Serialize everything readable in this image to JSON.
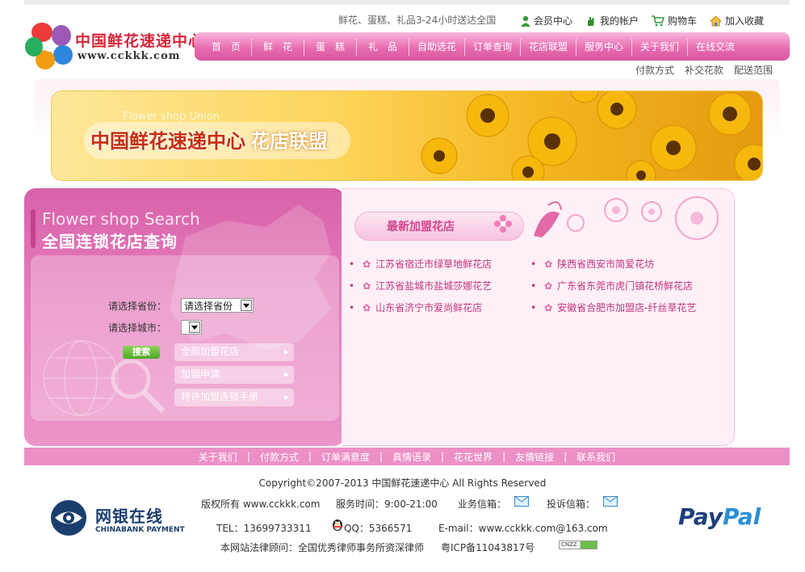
{
  "header": {
    "logo_cn": "中国鲜花速递中心",
    "logo_en": "www.cckkk.com",
    "tagline": "鲜花、蛋糕、礼品3-24小时送达全国",
    "toplinks": [
      "会员中心",
      "我的帐户",
      "购物车",
      "加入收藏"
    ]
  },
  "nav": {
    "items": [
      "首　页",
      "鲜　花",
      "蛋　糕",
      "礼　品",
      "自助选花",
      "订单查询",
      "花店联盟",
      "服务中心",
      "关于我们",
      "在线交流"
    ]
  },
  "subnav": [
    "付款方式",
    "补交花款",
    "配送范围"
  ],
  "banner": {
    "en": "Flower shop Union",
    "cn_main": "中国鲜花速递中心",
    "cn_sub": "花店联盟"
  },
  "search": {
    "title_en": "Flower shop Search",
    "title_cn": "全国连锁花店查询",
    "province_label": "请选择省份：",
    "province_value": "请选择省份",
    "city_label": "请选择城市：",
    "city_value": "",
    "button": "搜索",
    "links": [
      "全部加盟花店",
      "加盟申请",
      "特许加盟连锁手册"
    ]
  },
  "members": {
    "title": "最新加盟花店",
    "left": [
      "江苏省宿迁市绿草地鲜花店",
      "江苏省盐城市盐城莎娜花艺",
      "山东省济宁市爱尚鲜花店"
    ],
    "right": [
      "陕西省西安市简爱花坊",
      "广东省东莞市虎门镇花桥鲜花店",
      "安徽省合肥市加盟店-纤丝草花艺"
    ]
  },
  "footer": {
    "nav": [
      "关于我们",
      "付款方式",
      "订单满意度",
      "真情语录",
      "花花世界",
      "友情链接",
      "联系我们"
    ],
    "copyright": "Copyright©2007-2013 中国鲜花速递中心 All Rights Reserved",
    "rights": "版权所有 www.cckkk.com",
    "hours": "服务时间：9:00-21:00",
    "biz_mail": "业务信箱：",
    "complaint_mail": "投诉信箱：",
    "tel": "TEL：13699733311",
    "qq": "QQ：5366571",
    "email": "E-mail：www.cckkk.com@163.com",
    "legal": "本网站法律顾问：全国优秀律师事务所资深律师",
    "icp": "粤ICP备11043817号",
    "cnzz": "CNZZ",
    "chinabank_cn": "网银在线",
    "chinabank_en": "CHINABANK PAYMENT",
    "paypal_1": "Pay",
    "paypal_2": "Pal"
  },
  "colors": {
    "nav_pink": "#e86db2",
    "accent_pink": "#c0347f",
    "banner_yellow": "#fdd55b",
    "footer_nav": "#ec8fc6"
  }
}
